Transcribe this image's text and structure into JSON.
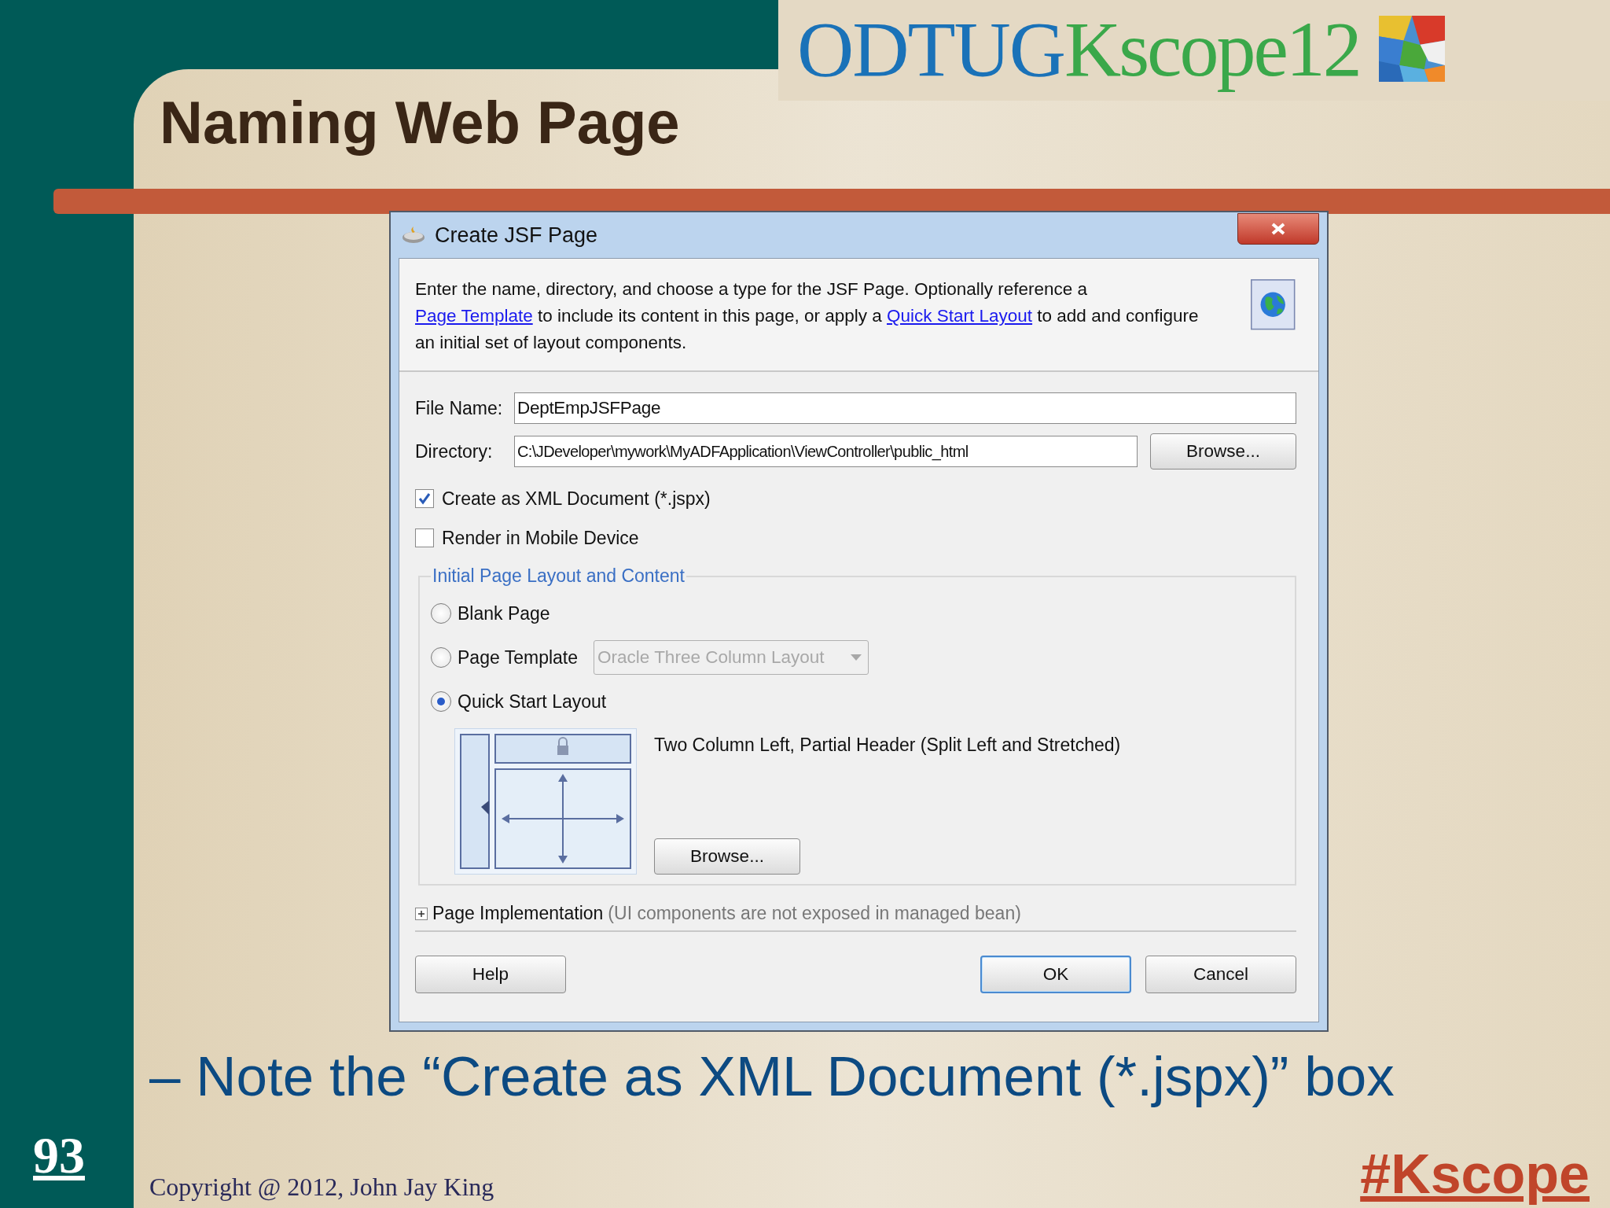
{
  "slide": {
    "title": "Naming Web Page",
    "logo": {
      "text_1": "ODTUG",
      "text_2": "Kscope12"
    },
    "bullet": "– Note the “Create as XML Document (*.jspx)” box",
    "page_number": "93",
    "copyright": "Copyright @ 2012, John Jay King",
    "hashtag": "#Kscope"
  },
  "dialog": {
    "title": "Create JSF Page",
    "description": [
      {
        "kind": "text",
        "text": "Enter the name, directory, and choose a type for the JSF Page. Optionally reference a "
      },
      {
        "kind": "link",
        "text": "Page Template"
      },
      {
        "kind": "text",
        "text": " to include its content in this page, or apply a "
      },
      {
        "kind": "link",
        "text": "Quick Start Layout"
      },
      {
        "kind": "text",
        "text": " to add and configure an initial set of layout components."
      }
    ],
    "file_name": {
      "label": "File Name:",
      "value": "DeptEmpJSFPage"
    },
    "directory": {
      "label": "Directory:",
      "value": "C:\\JDeveloper\\mywork\\MyADFApplication\\ViewController\\public_html",
      "button": "Browse..."
    },
    "checkboxes": [
      {
        "label": "Create as XML Document (*.jspx)",
        "checked": true
      },
      {
        "label": "Render in Mobile Device",
        "checked": false
      }
    ],
    "layout": {
      "legend": "Initial Page Layout and Content",
      "options": [
        {
          "label": "Blank Page",
          "selected": false
        },
        {
          "label": "Page Template",
          "selected": false
        },
        {
          "label": "Quick Start Layout",
          "selected": true
        }
      ],
      "template_dropdown": {
        "value": "Oracle Three Column Layout",
        "disabled": true
      },
      "quick_start_name": "Two Column Left, Partial Header (Split Left and Stretched)",
      "browse_button": "Browse..."
    },
    "implementation": {
      "label": "Page Implementation",
      "note": "(UI components are not exposed in managed bean)",
      "expanded": false
    },
    "buttons": [
      {
        "label": "Help",
        "default": false
      },
      {
        "label": "OK",
        "default": true
      },
      {
        "label": "Cancel",
        "default": false
      }
    ]
  }
}
